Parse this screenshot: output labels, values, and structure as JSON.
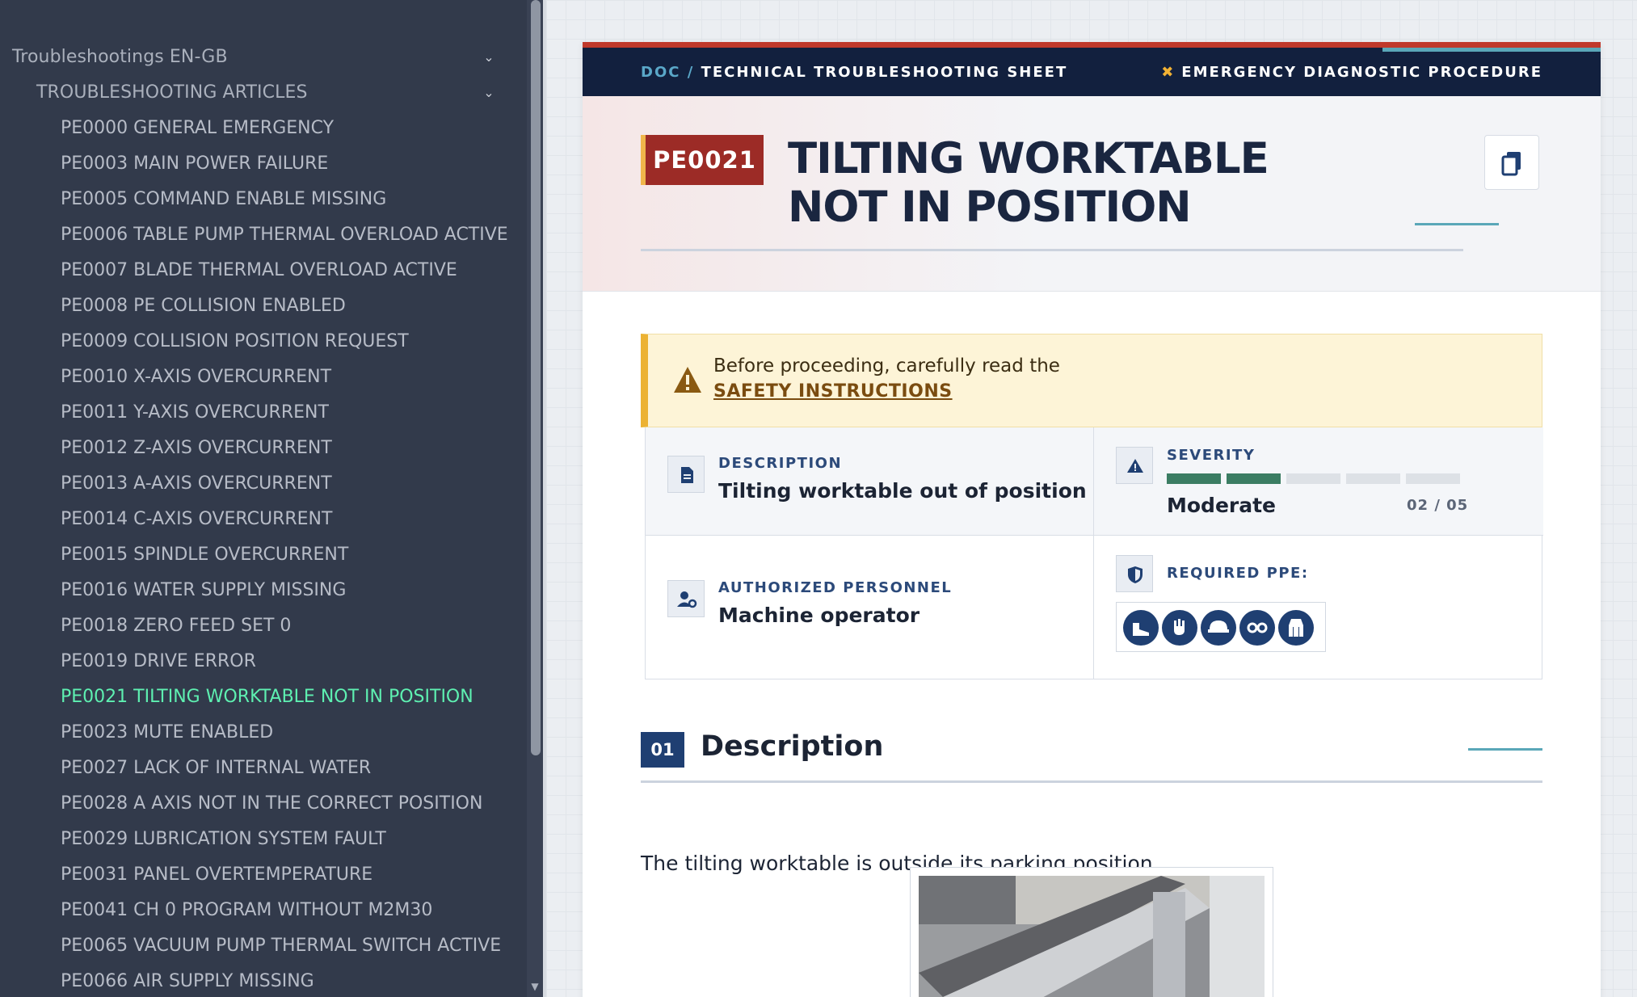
{
  "sidebar": {
    "root_label": "Troubleshootings EN-GB",
    "group_label": "TROUBLESHOOTING ARTICLES",
    "items": [
      {
        "label": "PE0000 GENERAL EMERGENCY"
      },
      {
        "label": "PE0003 MAIN POWER FAILURE"
      },
      {
        "label": "PE0005 COMMAND ENABLE MISSING"
      },
      {
        "label": "PE0006 TABLE PUMP THERMAL OVERLOAD ACTIVE"
      },
      {
        "label": "PE0007 BLADE THERMAL OVERLOAD ACTIVE"
      },
      {
        "label": "PE0008 PE COLLISION ENABLED"
      },
      {
        "label": "PE0009 COLLISION POSITION REQUEST"
      },
      {
        "label": "PE0010 X-AXIS OVERCURRENT"
      },
      {
        "label": "PE0011 Y-AXIS OVERCURRENT"
      },
      {
        "label": "PE0012 Z-AXIS OVERCURRENT"
      },
      {
        "label": "PE0013 A-AXIS OVERCURRENT"
      },
      {
        "label": "PE0014 C-AXIS OVERCURRENT"
      },
      {
        "label": "PE0015 SPINDLE OVERCURRENT"
      },
      {
        "label": "PE0016 WATER SUPPLY MISSING"
      },
      {
        "label": "PE0018 ZERO FEED SET 0"
      },
      {
        "label": "PE0019 DRIVE ERROR"
      },
      {
        "label": "PE0021 TILTING WORKTABLE NOT IN POSITION",
        "active": true
      },
      {
        "label": "PE0023 MUTE ENABLED"
      },
      {
        "label": "PE0027 LACK OF INTERNAL WATER"
      },
      {
        "label": "PE0028 A AXIS NOT IN THE CORRECT POSITION"
      },
      {
        "label": "PE0029 LUBRICATION SYSTEM FAULT"
      },
      {
        "label": "PE0031 PANEL OVERTEMPERATURE"
      },
      {
        "label": "PE0041 CH 0 PROGRAM WITHOUT M2M30"
      },
      {
        "label": "PE0065 VACUUM PUMP THERMAL SWITCH ACTIVE"
      },
      {
        "label": "PE0066 AIR SUPPLY MISSING"
      }
    ],
    "active_color": "#5ef0b1"
  },
  "doc_bar": {
    "prefix": "DOC /",
    "crumb": "TECHNICAL TROUBLESHOOTING SHEET",
    "procedure": "EMERGENCY DIAGNOSTIC PROCEDURE",
    "procedure_icon": "tools-icon"
  },
  "hero": {
    "code": "PE0021",
    "title": "TILTING WORKTABLE NOT IN POSITION",
    "copy_icon": "copy-icon"
  },
  "warning": {
    "text": "Before proceeding, carefully read the",
    "link": "SAFETY INSTRUCTIONS",
    "icon": "warning-icon"
  },
  "info": {
    "description_label": "DESCRIPTION",
    "description_value": "Tilting worktable out of position",
    "severity_label": "SEVERITY",
    "severity_value": "Moderate",
    "severity_count": "02 / 05",
    "severity_level": 2,
    "severity_max": 5,
    "personnel_label": "AUTHORIZED PERSONNEL",
    "personnel_value": "Machine operator",
    "ppe_label": "REQUIRED PPE:",
    "ppe_icons": [
      "safety-boots-icon",
      "gloves-icon",
      "hard-hat-icon",
      "goggles-icon",
      "overalls-icon"
    ]
  },
  "section": {
    "number": "01",
    "title": "Description",
    "body": "The tilting worktable is outside its parking position."
  },
  "colors": {
    "navy": "#12203e",
    "brand_red": "#9c2b26",
    "accent_yellow": "#ecb233",
    "teal": "#5aa7b8",
    "severity_filled": "#3b7d63",
    "severity_empty": "#dde1e6"
  }
}
